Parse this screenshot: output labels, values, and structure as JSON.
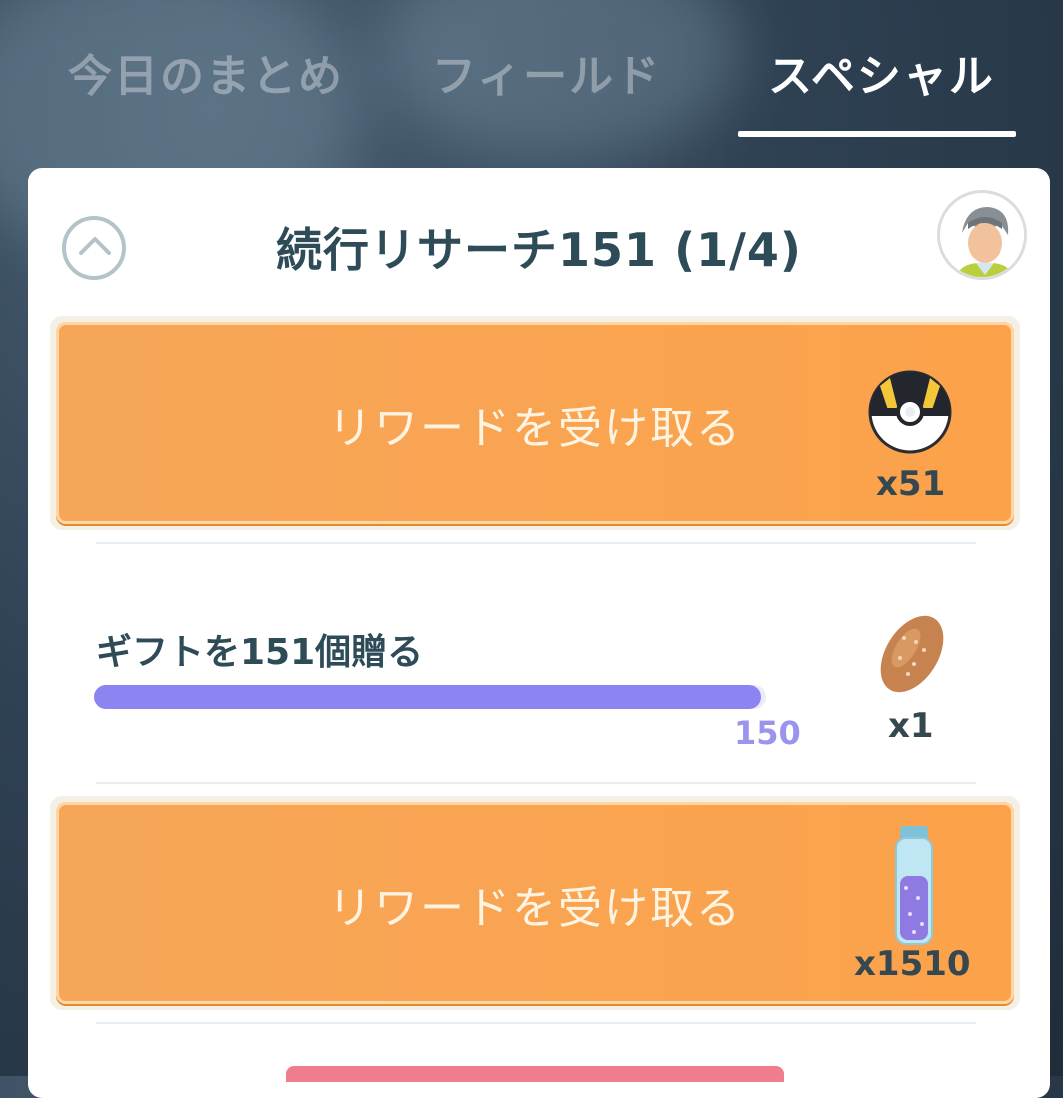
{
  "tabs": [
    {
      "label": "今日のまとめ",
      "active": false
    },
    {
      "label": "フィールド",
      "active": false
    },
    {
      "label": "スペシャル",
      "active": true
    }
  ],
  "research": {
    "title": "続行リサーチ151 (1/4)"
  },
  "rewards": [
    {
      "label": "リワードを受け取る",
      "count": "x51",
      "icon": "ultra-ball-icon"
    },
    {
      "label": "リワードを受け取る",
      "count": "x1510",
      "icon": "stardust-icon"
    }
  ],
  "task": {
    "title": "ギフトを151個贈る",
    "progress_value": "150",
    "progress_fraction": 0.993,
    "reward_count": "x1",
    "reward_icon": "pinap-berry-icon"
  },
  "colors": {
    "accent_orange": "#fca24a",
    "progress_purple": "#8b84f1",
    "title_text": "#2e4b58"
  }
}
